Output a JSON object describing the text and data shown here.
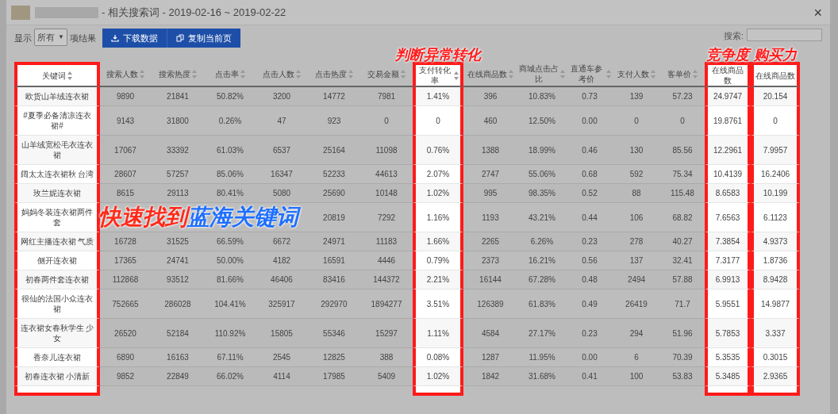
{
  "window": {
    "title": "- 相关搜索词 - 2019-02-16 ~ 2019-02-22",
    "close": "×"
  },
  "toolbar": {
    "show_label": "显示",
    "page_size": "所有",
    "page_size_arrow": "▼",
    "result_label": "项结果",
    "buttons": [
      {
        "kind": "download",
        "label": "下载数据"
      },
      {
        "kind": "copy",
        "label": "复制当前页"
      }
    ],
    "search_label": "搜索:"
  },
  "table": {
    "columns": [
      {
        "label": "关键词",
        "sortable": true,
        "highlighted": true
      },
      {
        "label": "搜索人数",
        "sortable": true,
        "highlighted": false
      },
      {
        "label": "搜索热度",
        "sortable": true,
        "highlighted": false
      },
      {
        "label": "点击率",
        "sortable": true,
        "highlighted": false
      },
      {
        "label": "点击人数",
        "sortable": true,
        "highlighted": false
      },
      {
        "label": "点击热度",
        "sortable": true,
        "highlighted": false
      },
      {
        "label": "交易金额",
        "sortable": true,
        "highlighted": false
      },
      {
        "label": "支付转化率",
        "sortable": true,
        "highlighted": true,
        "callout": "判断异常转化"
      },
      {
        "label": "在线商品数",
        "sortable": true,
        "highlighted": false
      },
      {
        "label": "商城点击占比",
        "sortable": true,
        "highlighted": false
      },
      {
        "label": "直通车参考价",
        "sortable": true,
        "highlighted": false
      },
      {
        "label": "支付人数",
        "sortable": true,
        "highlighted": false
      },
      {
        "label": "客单价",
        "sortable": true,
        "highlighted": false
      },
      {
        "label": "在线商品数",
        "sortable": false,
        "highlighted": true,
        "callout": "竞争度"
      },
      {
        "label": "在线商品数",
        "sortable": false,
        "highlighted": true,
        "callout": "购买力"
      }
    ],
    "rows": [
      [
        "欧货山羊绒连衣裙",
        "9890",
        "21841",
        "50.82%",
        "3200",
        "14772",
        "7981",
        "1.41%",
        "396",
        "10.83%",
        "0.73",
        "139",
        "57.23",
        "24.9747",
        "20.154"
      ],
      [
        "#夏季必备清凉连衣裙#",
        "9143",
        "31800",
        "0.26%",
        "47",
        "923",
        "0",
        "0",
        "460",
        "12.50%",
        "0.00",
        "0",
        "0",
        "19.8761",
        "0"
      ],
      [
        "山羊绒宽松毛衣连衣裙",
        "17067",
        "33392",
        "61.03%",
        "6537",
        "25164",
        "11098",
        "0.76%",
        "1388",
        "18.99%",
        "0.46",
        "130",
        "85.56",
        "12.2961",
        "7.9957"
      ],
      [
        "阔太太连衣裙秋 台湾",
        "28607",
        "57257",
        "85.06%",
        "16347",
        "52233",
        "44613",
        "2.07%",
        "2747",
        "55.06%",
        "0.68",
        "592",
        "75.34",
        "10.4139",
        "16.2406"
      ],
      [
        "玫兰妮连衣裙",
        "8615",
        "29113",
        "80.41%",
        "5080",
        "25690",
        "10148",
        "1.02%",
        "995",
        "98.35%",
        "0.52",
        "88",
        "115.48",
        "8.6583",
        "10.199"
      ],
      [
        "妈妈冬装连衣裙两件套",
        "",
        "",
        "",
        "",
        "20819",
        "7292",
        "1.16%",
        "1193",
        "43.21%",
        "0.44",
        "106",
        "68.82",
        "7.6563",
        "6.1123"
      ],
      [
        "网红主播连衣裙 气质",
        "16728",
        "31525",
        "66.59%",
        "6672",
        "24971",
        "11183",
        "1.66%",
        "2265",
        "6.26%",
        "0.23",
        "278",
        "40.27",
        "7.3854",
        "4.9373"
      ],
      [
        "侧开连衣裙",
        "17365",
        "24741",
        "50.00%",
        "4182",
        "16591",
        "4446",
        "0.79%",
        "2373",
        "16.21%",
        "0.56",
        "137",
        "32.41",
        "7.3177",
        "1.8736"
      ],
      [
        "初春两件套连衣裙",
        "112868",
        "93512",
        "81.66%",
        "46406",
        "83416",
        "144372",
        "2.21%",
        "16144",
        "67.28%",
        "0.48",
        "2494",
        "57.88",
        "6.9913",
        "8.9428"
      ],
      [
        "很仙的法国小众连衣裙",
        "752665",
        "286028",
        "104.41%",
        "325917",
        "292970",
        "1894277",
        "3.51%",
        "126389",
        "61.83%",
        "0.49",
        "26419",
        "71.7",
        "5.9551",
        "14.9877"
      ],
      [
        "连衣裙女春秋学生 少女",
        "26520",
        "52184",
        "110.92%",
        "15805",
        "55346",
        "15297",
        "1.11%",
        "4584",
        "27.17%",
        "0.23",
        "294",
        "51.96",
        "5.7853",
        "3.337"
      ],
      [
        "香奈儿连衣裙",
        "6890",
        "16163",
        "67.11%",
        "2545",
        "12825",
        "388",
        "0.08%",
        "1287",
        "11.95%",
        "0.00",
        "6",
        "70.39",
        "5.3535",
        "0.3015"
      ],
      [
        "初春连衣裙 小清新",
        "9852",
        "22849",
        "66.02%",
        "4114",
        "17985",
        "5409",
        "1.02%",
        "1842",
        "31.68%",
        "0.41",
        "100",
        "53.83",
        "5.3485",
        "2.9365"
      ]
    ]
  },
  "banner": {
    "parts": [
      {
        "text": "快速找到",
        "color": "#ff2a1a"
      },
      {
        "text": "蓝海关键词",
        "color": "#1e6fff"
      }
    ]
  }
}
